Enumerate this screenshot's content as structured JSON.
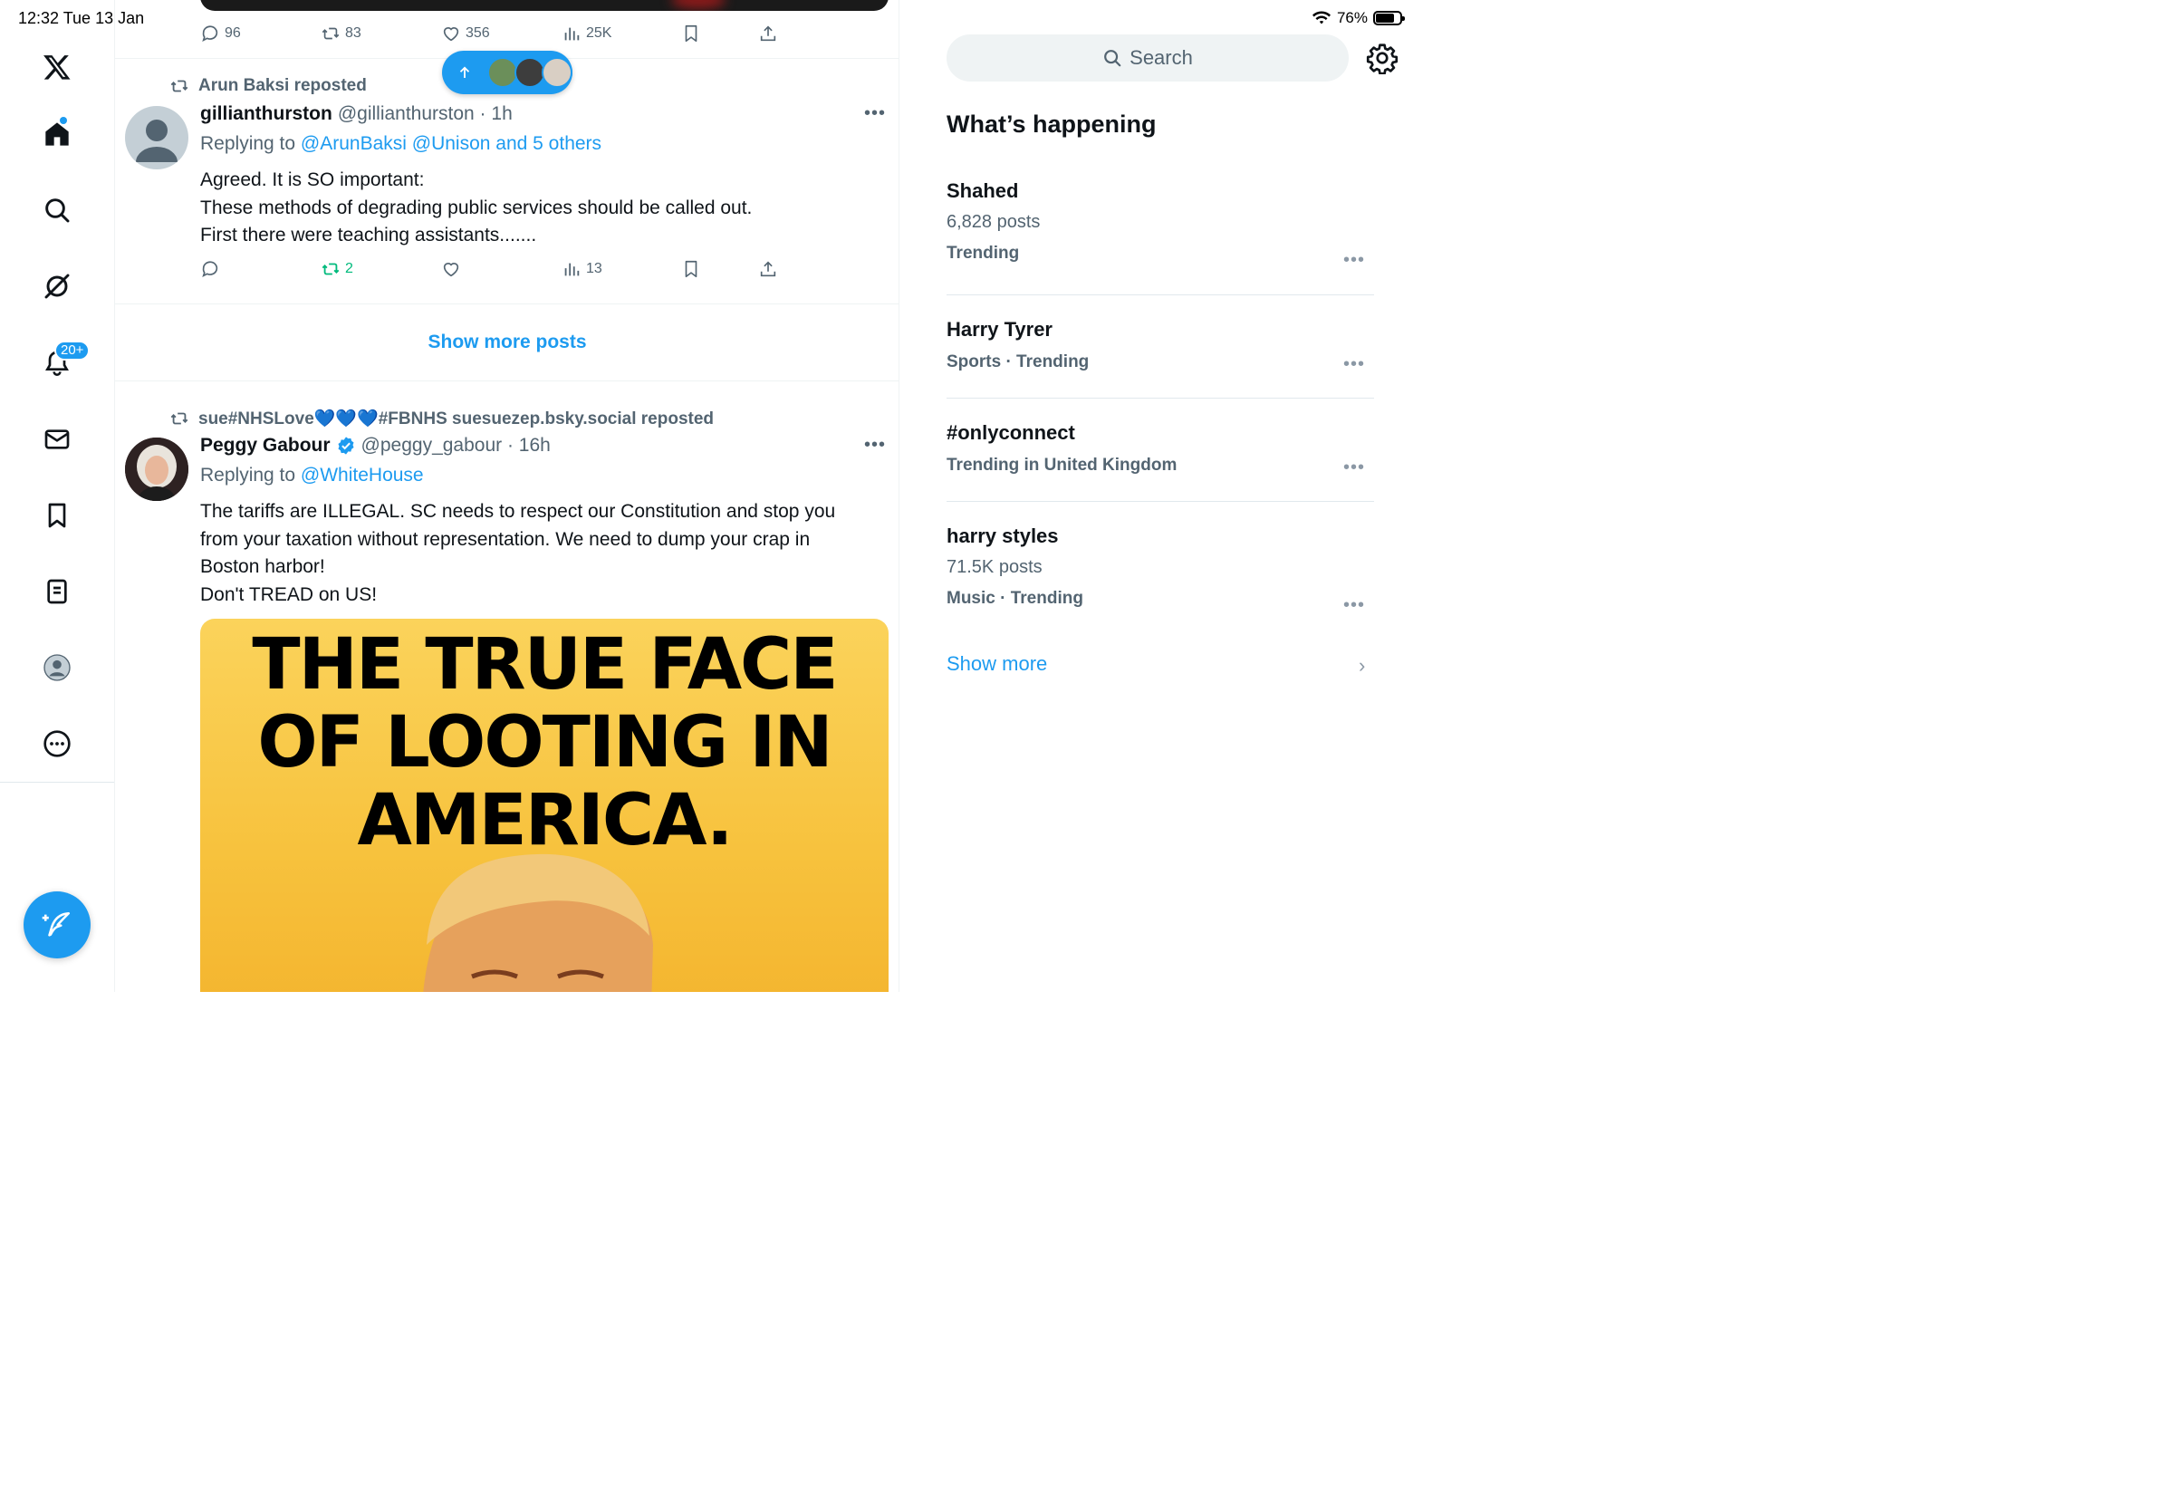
{
  "status_bar": {
    "time_date": "12:32  Tue 13 Jan",
    "battery": "76%",
    "battery_level": 0.76
  },
  "nav": {
    "notifications_badge": "20+"
  },
  "top_tweet_actions": {
    "replies": "96",
    "reposts": "83",
    "likes": "356",
    "views": "25K"
  },
  "tweet1": {
    "repost_by": "Arun Baksi reposted",
    "name": "gillianthurston",
    "handle_time": "@gillianthurston · 1h",
    "replying_prefix": "Replying to",
    "replying_mentions": "@ArunBaksi @Unison and 5 others",
    "text": "Agreed. It is SO important:\nThese methods of degrading  public services should be called out.\nFirst there were teaching assistants.......",
    "replies": "",
    "reposts": "2",
    "likes": "",
    "views": "13"
  },
  "show_more_posts": "Show more posts",
  "tweet2": {
    "repost_by": "sue#NHSLove💙💙💙#FBNHS suesuezep.bsky.social reposted",
    "name": "Peggy Gabour",
    "handle_time": "@peggy_gabour · 16h",
    "replying_prefix": "Replying to",
    "replying_mentions": "@WhiteHouse",
    "text": "The tariffs are ILLEGAL. SC needs to respect our Constitution and stop you\nfrom your taxation without representation. We need to dump your crap in\nBoston harbor!\nDon't TREAD on US!",
    "media_headline": "THE TRUE FACE\nOF LOOTING IN\nAMERICA."
  },
  "sidebar": {
    "search_placeholder": "Search",
    "title": "What’s happening",
    "trends": [
      {
        "name": "Shahed",
        "posts": "6,828 posts",
        "meta": "Trending"
      },
      {
        "name": "Harry Tyrer",
        "posts": "",
        "meta": "Sports · Trending"
      },
      {
        "name": "#onlyconnect",
        "posts": "",
        "meta": "Trending in United Kingdom"
      },
      {
        "name": "harry styles",
        "posts": "71.5K posts",
        "meta": "Music · Trending"
      }
    ],
    "show_more": "Show more"
  },
  "colors": {
    "accent": "#1d9bf0",
    "repost_active": "#00ba7c",
    "secondary_text": "#536471"
  }
}
